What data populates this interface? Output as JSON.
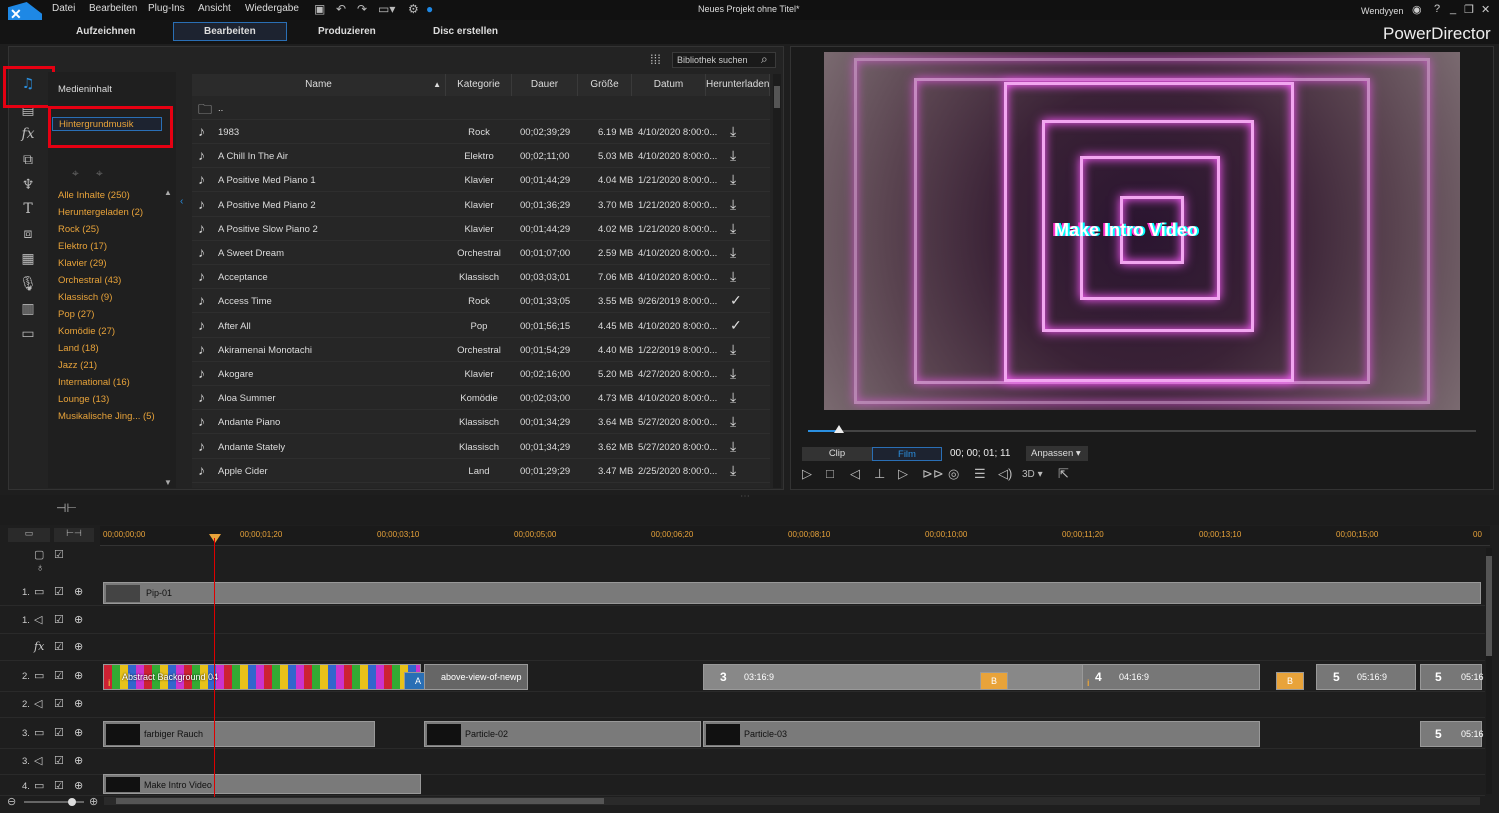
{
  "menubar": {
    "items": [
      "Datei",
      "Bearbeiten",
      "Plug-Ins",
      "Ansicht",
      "Wiedergabe"
    ],
    "title": "Neues Projekt ohne Titel*",
    "user": "Wendyyen"
  },
  "modes": [
    "Aufzeichnen",
    "Bearbeiten",
    "Produzieren",
    "Disc erstellen"
  ],
  "brand": "PowerDirector",
  "library": {
    "content_title": "Medieninhalt",
    "selected_category": "Hintergrundmusik",
    "search_placeholder": "Bibliothek suchen",
    "categories": [
      "Alle Inhalte  (250)",
      "Heruntergeladen  (2)",
      "Rock  (25)",
      "Elektro  (17)",
      "Klavier  (29)",
      "Orchestral  (43)",
      "Klassisch  (9)",
      "Pop  (27)",
      "Komödie  (27)",
      "Land  (18)",
      "Jazz  (21)",
      "International  (16)",
      "Lounge  (13)",
      "Musikalische Jing...  (5)"
    ],
    "columns": [
      "Name",
      "Kategorie",
      "Dauer",
      "Größe",
      "Datum",
      "Herunterladen"
    ],
    "parent_row": "..",
    "rows": [
      {
        "name": "1983",
        "cat": "Rock",
        "dur": "00;02;39;29",
        "size": "6.19 MB",
        "date": "4/10/2020 8:00:0...",
        "dl": "download"
      },
      {
        "name": "A Chill In The Air",
        "cat": "Elektro",
        "dur": "00;02;11;00",
        "size": "5.03 MB",
        "date": "4/10/2020 8:00:0...",
        "dl": "download"
      },
      {
        "name": "A Positive Med Piano 1",
        "cat": "Klavier",
        "dur": "00;01;44;29",
        "size": "4.04 MB",
        "date": "1/21/2020 8:00:0...",
        "dl": "download"
      },
      {
        "name": "A Positive Med Piano 2",
        "cat": "Klavier",
        "dur": "00;01;36;29",
        "size": "3.70 MB",
        "date": "1/21/2020 8:00:0...",
        "dl": "download"
      },
      {
        "name": "A Positive Slow Piano 2",
        "cat": "Klavier",
        "dur": "00;01;44;29",
        "size": "4.02 MB",
        "date": "1/21/2020 8:00:0...",
        "dl": "download"
      },
      {
        "name": "A Sweet Dream",
        "cat": "Orchestral",
        "dur": "00;01;07;00",
        "size": "2.59 MB",
        "date": "4/10/2020 8:00:0...",
        "dl": "download"
      },
      {
        "name": "Acceptance",
        "cat": "Klassisch",
        "dur": "00;03;03;01",
        "size": "7.06 MB",
        "date": "4/10/2020 8:00:0...",
        "dl": "download"
      },
      {
        "name": "Access Time",
        "cat": "Rock",
        "dur": "00;01;33;05",
        "size": "3.55 MB",
        "date": "9/26/2019 8:00:0...",
        "dl": "check"
      },
      {
        "name": "After All",
        "cat": "Pop",
        "dur": "00;01;56;15",
        "size": "4.45 MB",
        "date": "4/10/2020 8:00:0...",
        "dl": "check"
      },
      {
        "name": "Akiramenai Monotachi",
        "cat": "Orchestral",
        "dur": "00;01;54;29",
        "size": "4.40 MB",
        "date": "1/22/2019 8:00:0...",
        "dl": "download"
      },
      {
        "name": "Akogare",
        "cat": "Klavier",
        "dur": "00;02;16;00",
        "size": "5.20 MB",
        "date": "4/27/2020 8:00:0...",
        "dl": "download"
      },
      {
        "name": "Aloa Summer",
        "cat": "Komödie",
        "dur": "00;02;03;00",
        "size": "4.73 MB",
        "date": "4/10/2020 8:00:0...",
        "dl": "download"
      },
      {
        "name": "Andante Piano",
        "cat": "Klassisch",
        "dur": "00;01;34;29",
        "size": "3.64 MB",
        "date": "5/27/2020 8:00:0...",
        "dl": "download"
      },
      {
        "name": "Andante Stately",
        "cat": "Klassisch",
        "dur": "00;01;34;29",
        "size": "3.62 MB",
        "date": "5/27/2020 8:00:0...",
        "dl": "download"
      },
      {
        "name": "Apple Cider",
        "cat": "Land",
        "dur": "00;01;29;29",
        "size": "3.47 MB",
        "date": "2/25/2020 8:00:0...",
        "dl": "download"
      }
    ]
  },
  "preview": {
    "video_title": "Make Intro Video",
    "clip": "Clip",
    "film": "Film",
    "timecode": "00; 00; 01; 11",
    "fit": "Anpassen",
    "mode3d": "3D"
  },
  "timeline": {
    "ticks": [
      "00;00;00;00",
      "00;00;01;20",
      "00;00;03;10",
      "00;00;05;00",
      "00;00;06;20",
      "00;00;08;10",
      "00;00;10;00",
      "00;00;11;20",
      "00;00;13;10",
      "00;00;15;00",
      "00"
    ],
    "track_labels": [
      "1.",
      "1.",
      "",
      "2.",
      "2.",
      "3.",
      "3.",
      "4."
    ],
    "clips": {
      "pip": "Pip-01",
      "abstract": "Abstract Background 04",
      "above": "above-view-of-newp",
      "n3": "3",
      "t3": "03:16:9",
      "n4": "4",
      "t4": "04:16:9",
      "n5": "5",
      "t5": "05:16:9",
      "n5b": "5",
      "t5b": "05:16",
      "rauch": "farbiger Rauch",
      "p2": "Particle-02",
      "p3": "Particle-03",
      "n5c": "5",
      "t5c": "05:16",
      "intro": "Make Intro Video",
      "a": "A",
      "b": "B",
      "b2": "B"
    }
  },
  "colors": {
    "accent": "#e8a33a",
    "select": "#2a6fb5",
    "highlight": "#e60012"
  }
}
